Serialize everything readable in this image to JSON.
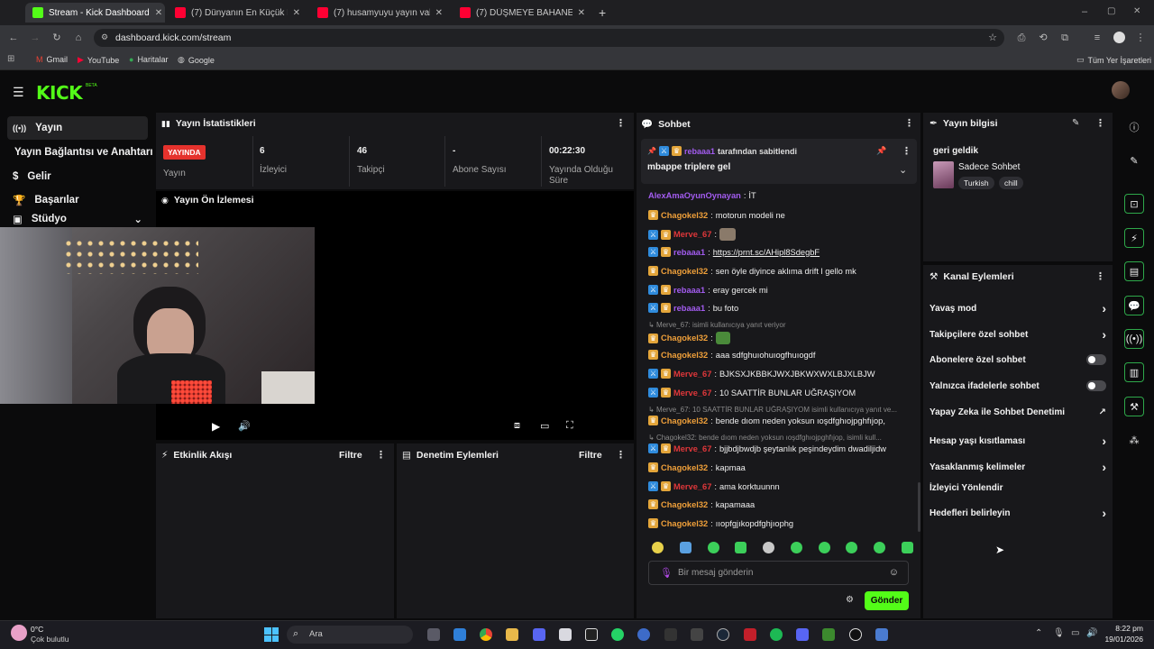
{
  "browser": {
    "tabs": [
      {
        "title": "Stream - Kick Dashboard",
        "active": true
      },
      {
        "title": "(7) Dünyanın En Küçük Evleri 1"
      },
      {
        "title": "(7) husamyuyu yayın vakti 14 -"
      },
      {
        "title": "(7) DÜŞMEYE BAHANE ARAMA!"
      }
    ],
    "url": "dashboard.kick.com/stream",
    "bookmarks": [
      "Gmail",
      "YouTube",
      "Haritalar",
      "Google"
    ],
    "all_bookmarks": "Tüm Yer İşaretleri"
  },
  "kick": {
    "logo": "KICK",
    "beta": "BETA"
  },
  "sidebar": {
    "items": [
      {
        "label": "Yayın",
        "icon": "broadcast-icon"
      },
      {
        "label": "Yayın Bağlantısı ve Anahtarı",
        "icon": "key-icon"
      },
      {
        "label": "Gelir",
        "icon": "dollar-icon"
      },
      {
        "label": "Başarılar",
        "icon": "trophy-icon"
      },
      {
        "label": "Stüdyo",
        "icon": "studio-icon"
      }
    ]
  },
  "stats": {
    "title": "Yayın İstatistikleri",
    "live_badge": "YAYINDA",
    "live_label": "Yayın",
    "viewers_value": "6",
    "viewers_label": "İzleyici",
    "followers_value": "46",
    "followers_label": "Takipçi",
    "subs_value": "-",
    "subs_label": "Abone Sayısı",
    "duration_value": "00:22:30",
    "duration_label": "Yayında Olduğu Süre"
  },
  "preview": {
    "title": "Yayın Ön İzlemesi"
  },
  "activity": {
    "title": "Etkinlik Akışı",
    "filter": "Filtre"
  },
  "moderation": {
    "title": "Denetim Eylemleri",
    "filter": "Filtre"
  },
  "chat": {
    "title": "Sohbet",
    "pinned_by": "rebaaa1",
    "pinned_suffix": "tarafından sabitlendi",
    "pinned_text": "mbappe triplere gel",
    "messages": [
      {
        "user": "AlexAmaOyunOynayan",
        "text": "İT",
        "color": "purple"
      },
      {
        "user": "Chagokel32",
        "text": "motorun modeli ne",
        "color": "orange"
      },
      {
        "user": "Merve_67",
        "text": "",
        "color": "red"
      },
      {
        "user": "rebaaa1",
        "text": "https://prnt.sc/AHipl8SdegbF",
        "color": "purple"
      },
      {
        "user": "Chagokel32",
        "text": "sen öyle diyince aklıma drift l gello mk",
        "color": "orange"
      },
      {
        "user": "rebaaa1",
        "text": "eray gercek mi",
        "color": "purple"
      },
      {
        "user": "rebaaa1",
        "text": "bu foto",
        "color": "purple"
      },
      {
        "user": "Chagokel32",
        "text": "",
        "color": "orange"
      },
      {
        "user": "Chagokel32",
        "text": "aaa sdfghuıohuıogfhuıogdf",
        "color": "orange"
      },
      {
        "user": "Merve_67",
        "text": "BJKSXJKBBKJWXJBKWXWXLBJXLBJW",
        "color": "red"
      },
      {
        "user": "Merve_67",
        "text": "10 SAATTİR BUNLAR UĞRAŞIYOM",
        "color": "red"
      },
      {
        "user": "Chagokel32",
        "text": "bende dıom neden yoksun ıoşdfghıojpghfıjop,",
        "color": "orange"
      },
      {
        "user": "Merve_67",
        "text": "bjjbdjbwdjb şeytanlık peşindeydim dwadiljidw",
        "color": "red"
      },
      {
        "user": "Chagokel32",
        "text": "kapmaa",
        "color": "orange"
      },
      {
        "user": "Merve_67",
        "text": "ama korktuunnn",
        "color": "red"
      },
      {
        "user": "Chagokel32",
        "text": "kapamaaa",
        "color": "orange"
      },
      {
        "user": "Chagokel32",
        "text": "ııopfgjıkopdfghjıophg",
        "color": "orange"
      }
    ],
    "replies": [
      "Merve_67: isimli kullanıcıya yanıt veriyor",
      "Merve_67: 10 SAATTİR BUNLAR UĞRAŞIYOM isimli kullanıcıya yanıt ve...",
      "Chagokel32: bende dıom neden yoksun ıoşdfghıojpghfıjop, isimli kull..."
    ],
    "input_placeholder": "Bir mesaj gönderin",
    "send_label": "Gönder"
  },
  "stream_info": {
    "title": "Yayın bilgisi",
    "stream_title": "geri geldik",
    "category": "Sadece Sohbet",
    "tags": [
      "Turkish",
      "chill"
    ]
  },
  "channel_actions": {
    "title": "Kanal Eylemleri",
    "items": [
      {
        "label": "Yavaş mod",
        "kind": "chevron"
      },
      {
        "label": "Takipçilere özel sohbet",
        "kind": "chevron"
      },
      {
        "label": "Abonelere özel sohbet",
        "kind": "toggle"
      },
      {
        "label": "Yalnızca ifadelerle sohbet",
        "kind": "toggle"
      },
      {
        "label": "Yapay Zeka ile Sohbet Denetimi",
        "kind": "external"
      },
      {
        "label": "Hesap yaşı kısıtlaması",
        "kind": "chevron"
      },
      {
        "label": "Yasaklanmış kelimeler",
        "kind": "chevron"
      },
      {
        "label": "İzleyici Yönlendir",
        "kind": "none"
      },
      {
        "label": "Hedefleri belirleyin",
        "kind": "chevron"
      }
    ]
  },
  "taskbar": {
    "weather_temp": "0°C",
    "weather_desc": "Çok bulutlu",
    "search": "Ara",
    "time": "8:22 pm",
    "date": "19/01/2026"
  },
  "colors": {
    "kick_green": "#53fc18",
    "live_red": "#e5322d",
    "panel": "#18181b"
  }
}
